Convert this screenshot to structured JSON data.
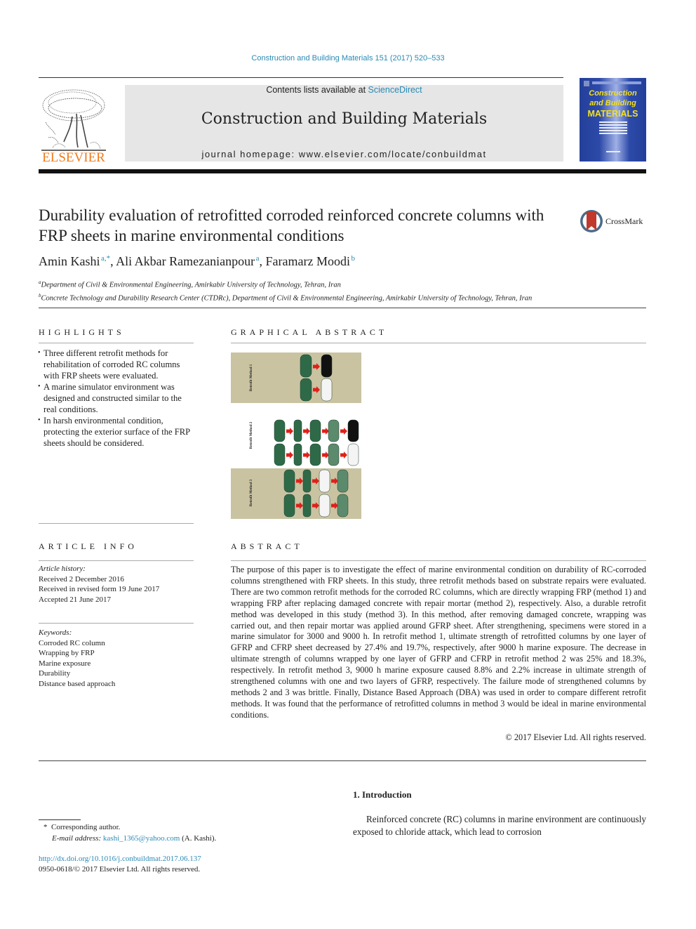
{
  "header": {
    "journal_ref": "Construction and Building Materials 151 (2017) 520–533",
    "contents_prefix": "Contents lists available at ",
    "contents_link": "ScienceDirect",
    "journal_title": "Construction and Building Materials",
    "homepage": "journal homepage: www.elsevier.com/locate/conbuildmat",
    "publisher_logo_text": "ELSEVIER",
    "cover": {
      "line1": "Construction",
      "line2": "and Building",
      "line3": "MATERIALS"
    },
    "colors": {
      "link": "#2a8ab4",
      "elsevier_orange": "#f07c1c",
      "banner_bg": "#e6e6e6",
      "cover_blue": "#2d4aa8",
      "cover_yellow": "#f4e020"
    }
  },
  "article": {
    "title": "Durability evaluation of retrofitted corroded reinforced concrete columns with FRP sheets in marine environmental conditions",
    "crossmark_label": "CrossMark",
    "authors": [
      {
        "name": "Amin Kashi",
        "sup": "a,*"
      },
      {
        "name": "Ali Akbar Ramezanianpour",
        "sup": "a"
      },
      {
        "name": "Faramarz Moodi",
        "sup": "b"
      }
    ],
    "affiliations": [
      {
        "sup": "a",
        "text": "Department of Civil & Environmental Engineering, Amirkabir University of Technology, Tehran, Iran"
      },
      {
        "sup": "b",
        "text": "Concrete Technology and Durability Research Center (CTDRc), Department of Civil & Environmental Engineering, Amirkabir University of Technology, Tehran, Iran"
      }
    ]
  },
  "highlights": {
    "heading": "HIGHLIGHTS",
    "items": [
      "Three different retrofit methods for rehabilitation of corroded RC columns with FRP sheets were evaluated.",
      "A marine simulator environment was designed and constructed similar to the real conditions.",
      "In harsh environmental condition, protecting the exterior surface of the FRP sheets should be considered."
    ]
  },
  "graphical_abstract": {
    "heading": "GRAPHICAL ABSTRACT",
    "labels": [
      "Retrofit Method 1",
      "Retrofit Method 2",
      "Retrofit Method 3"
    ]
  },
  "article_info": {
    "heading": "ARTICLE INFO",
    "history_label": "Article history:",
    "history": [
      "Received 2 December 2016",
      "Received in revised form 19 June 2017",
      "Accepted 21 June 2017"
    ],
    "keywords_label": "Keywords:",
    "keywords": [
      "Corroded RC column",
      "Wrapping by FRP",
      "Marine exposure",
      "Durability",
      "Distance based approach"
    ]
  },
  "abstract": {
    "heading": "ABSTRACT",
    "text": "The purpose of this paper is to investigate the effect of marine environmental condition on durability of RC-corroded columns strengthened with FRP sheets. In this study, three retrofit methods based on substrate repairs were evaluated. There are two common retrofit methods for the corroded RC columns, which are directly wrapping FRP (method 1) and wrapping FRP after replacing damaged concrete with repair mortar (method 2), respectively. Also, a durable retrofit method was developed in this study (method 3). In this method, after removing damaged concrete, wrapping was carried out, and then repair mortar was applied around GFRP sheet. After strengthening, specimens were stored in a marine simulator for 3000 and 9000 h. In retrofit method 1, ultimate strength of retrofitted columns by one layer of GFRP and CFRP sheet decreased by 27.4% and 19.7%, respectively, after 9000 h marine exposure. The decrease in ultimate strength of columns wrapped by one layer of GFRP and CFRP in retrofit method 2 was 25% and 18.3%, respectively. In retrofit method 3, 9000 h marine exposure caused 8.8% and 2.2% increase in ultimate strength of strengthened columns with one and two layers of GFRP, respectively. The failure mode of strengthened columns by methods 2 and 3 was brittle. Finally, Distance Based Approach (DBA) was used in order to compare different retrofit methods. It was found that the performance of retrofitted columns in method 3 would be ideal in marine environmental conditions.",
    "copyright": "© 2017 Elsevier Ltd. All rights reserved."
  },
  "introduction": {
    "heading": "1. Introduction",
    "text": "Reinforced concrete (RC) columns in marine environment are continuously exposed to chloride attack, which lead to corrosion"
  },
  "footnote": {
    "marker": "*",
    "corresponding": "Corresponding author.",
    "email_label": "E-mail address:",
    "email": "kashi_1365@yahoo.com",
    "email_suffix": " (A. Kashi).",
    "doi": "http://dx.doi.org/10.1016/j.conbuildmat.2017.06.137",
    "issn_line": "0950-0618/© 2017 Elsevier Ltd. All rights reserved."
  }
}
